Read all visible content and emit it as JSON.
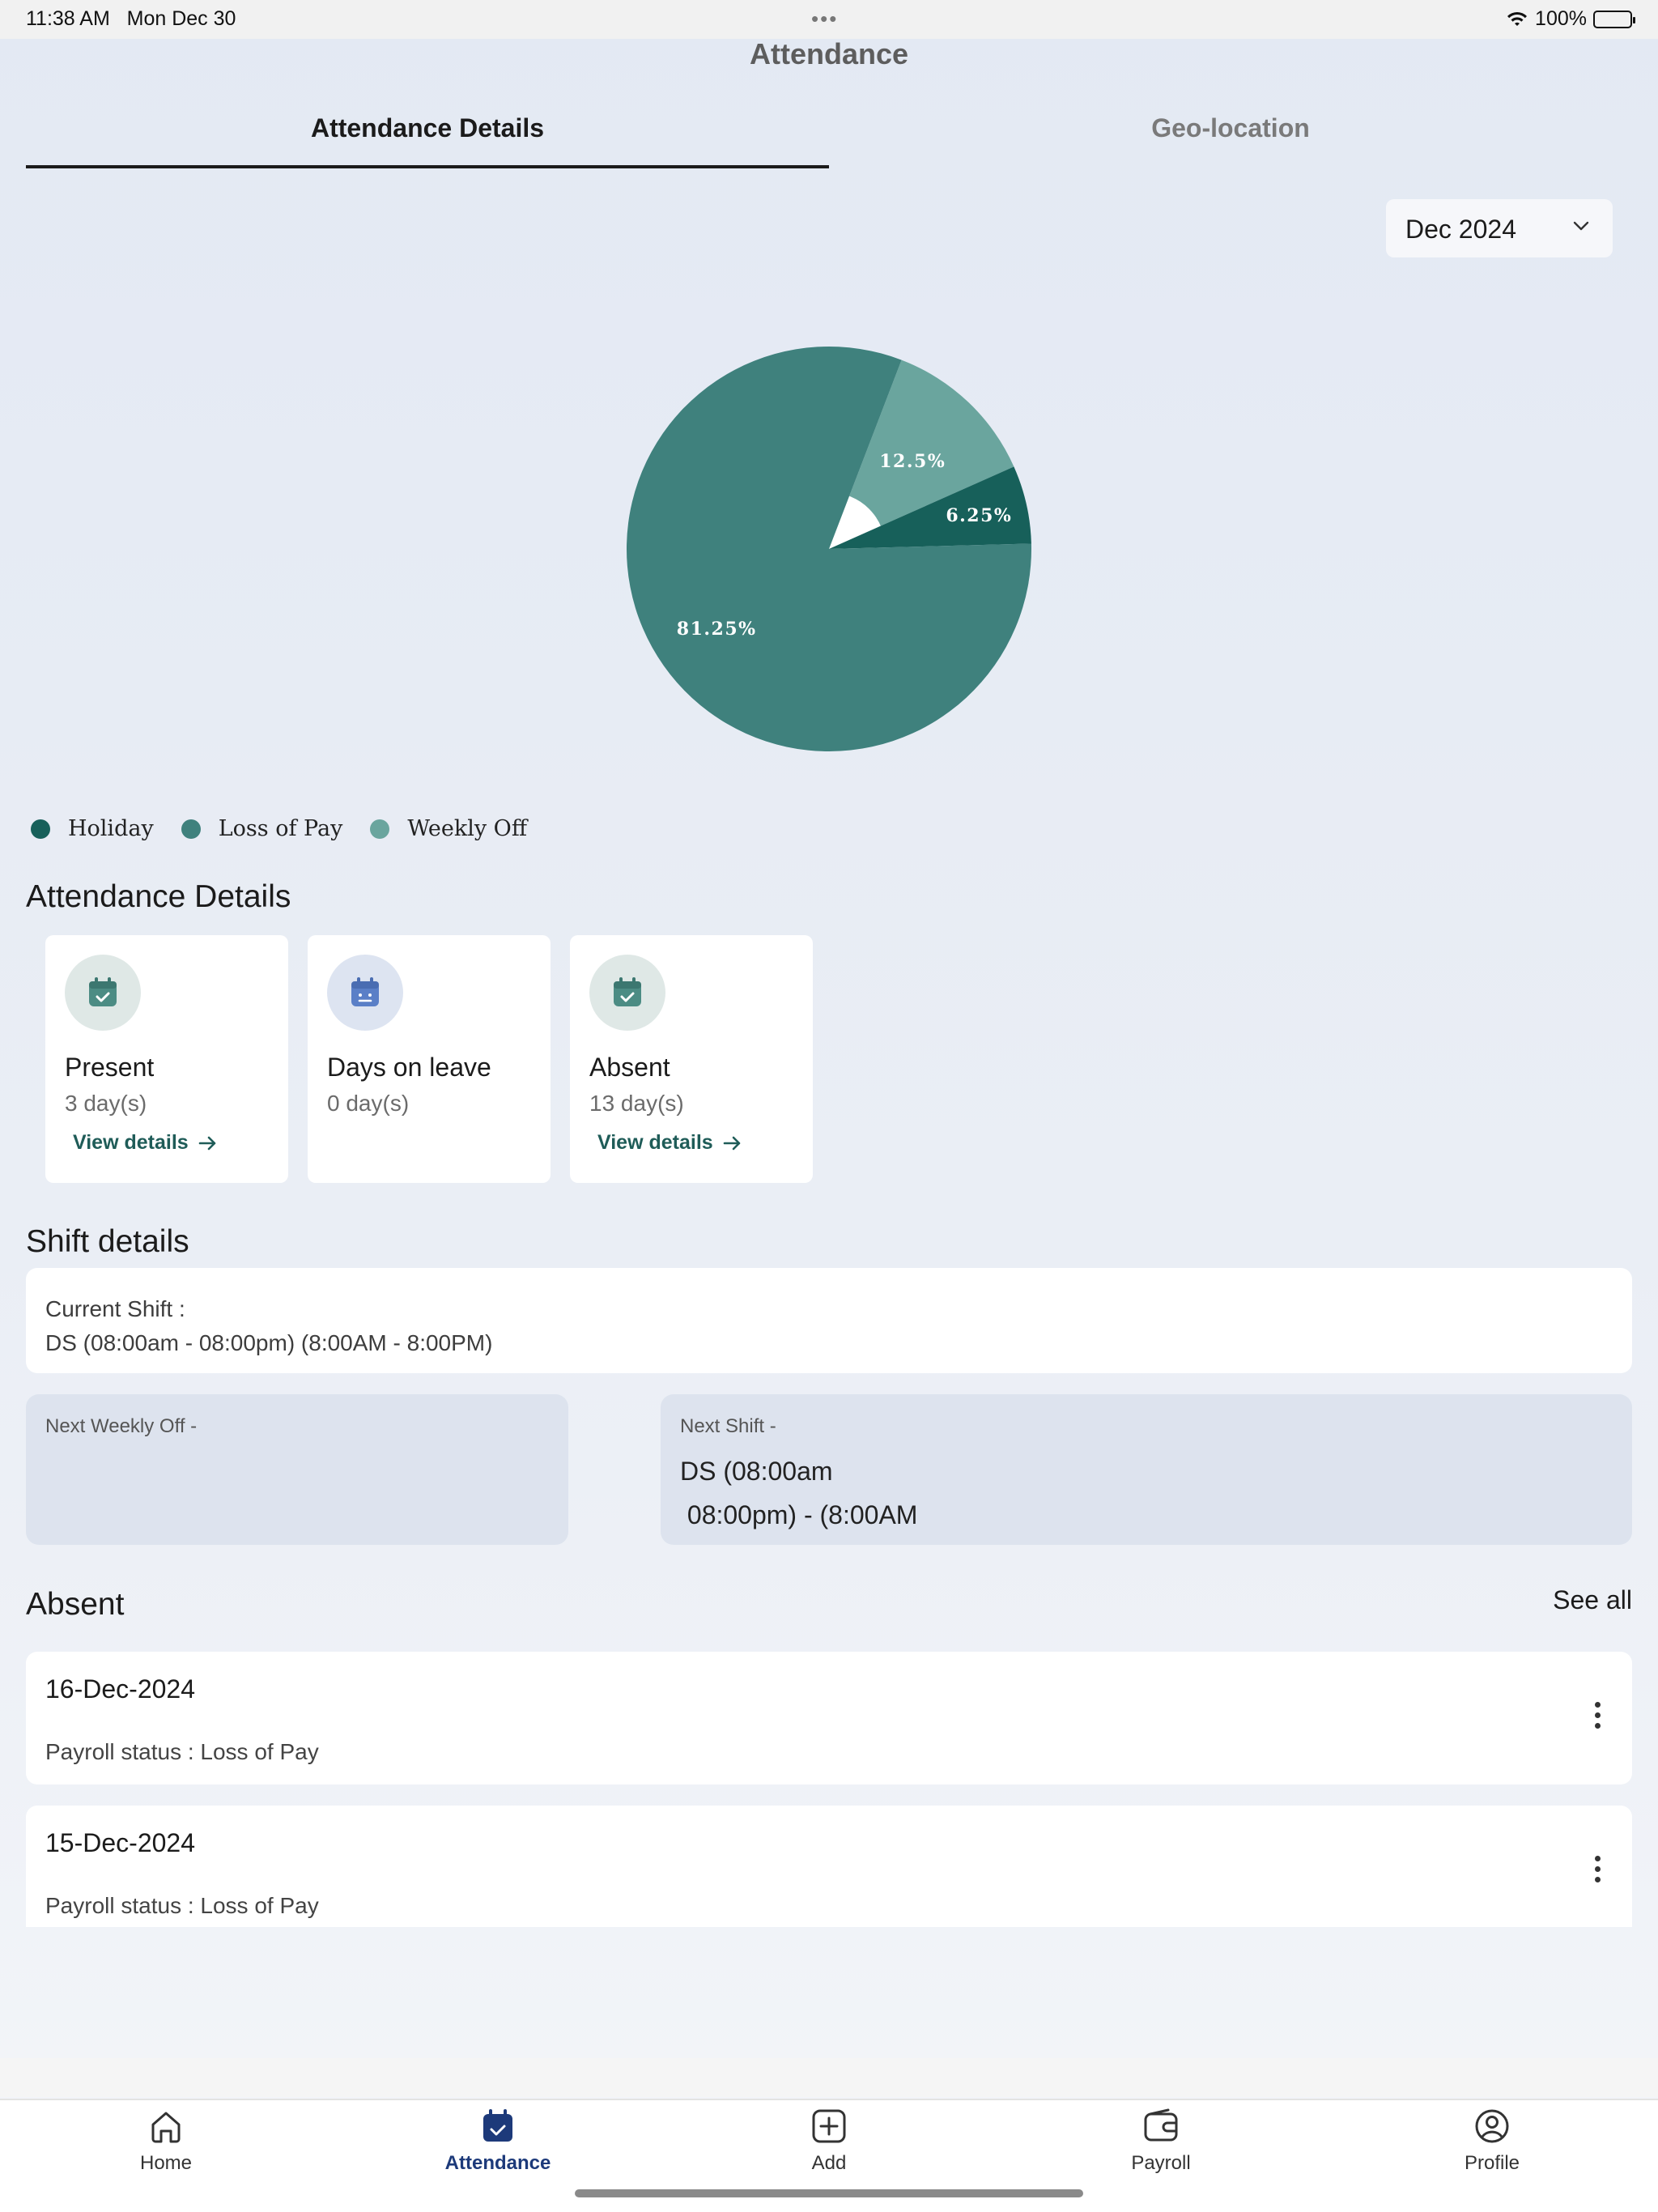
{
  "status_bar": {
    "time": "11:38 AM",
    "date": "Mon Dec 30",
    "dots": "•••",
    "battery": "100%"
  },
  "header": {
    "title": "Attendance"
  },
  "tabs": [
    {
      "label": "Attendance Details",
      "active": true
    },
    {
      "label": "Geo-location",
      "active": false
    }
  ],
  "month_select": {
    "value": "Dec 2024"
  },
  "chart_data": {
    "type": "pie",
    "slices": [
      {
        "label": "Loss of Pay",
        "value": 81.25,
        "display": "81.25%",
        "color": "#3f817d"
      },
      {
        "label": "Weekly Off",
        "value": 12.5,
        "display": "12.5%",
        "color": "#6aa59e"
      },
      {
        "label": "Holiday",
        "value": 6.25,
        "display": "6.25%",
        "color": "#17605a"
      }
    ],
    "legend": [
      {
        "label": "Holiday",
        "color": "#17605a"
      },
      {
        "label": "Loss of Pay",
        "color": "#3f817d"
      },
      {
        "label": "Weekly Off",
        "color": "#6aa59e"
      }
    ]
  },
  "attendance": {
    "title": "Attendance Details",
    "cards": [
      {
        "label": "Present",
        "value": "3 day(s)",
        "link": "View details",
        "icon": "calendar-check-icon"
      },
      {
        "label": "Days on leave",
        "value": "0 day(s)",
        "link": "",
        "icon": "calendar-leave-icon"
      },
      {
        "label": "Absent",
        "value": "13 day(s)",
        "link": "View details",
        "icon": "calendar-check-icon"
      }
    ]
  },
  "shift": {
    "title": "Shift details",
    "current_label": "Current Shift :",
    "current_value": "DS (08:00am - 08:00pm) (8:00AM - 8:00PM)",
    "next_weekly_off_label": "Next Weekly Off -",
    "next_shift_label": "Next Shift -",
    "next_shift_value": "DS (08:00am\n 08:00pm) - (8:00AM"
  },
  "absent": {
    "title": "Absent",
    "see_all": "See all",
    "items": [
      {
        "date": "16-Dec-2024",
        "status": "Payroll status : Loss of Pay"
      },
      {
        "date": "15-Dec-2024",
        "status": "Payroll status : Loss of Pay"
      }
    ]
  },
  "nav": [
    {
      "label": "Home",
      "icon": "home-icon",
      "active": false
    },
    {
      "label": "Attendance",
      "icon": "calendar-icon",
      "active": true
    },
    {
      "label": "Add",
      "icon": "add-icon",
      "active": false
    },
    {
      "label": "Payroll",
      "icon": "wallet-icon",
      "active": false
    },
    {
      "label": "Profile",
      "icon": "profile-icon",
      "active": false
    }
  ]
}
